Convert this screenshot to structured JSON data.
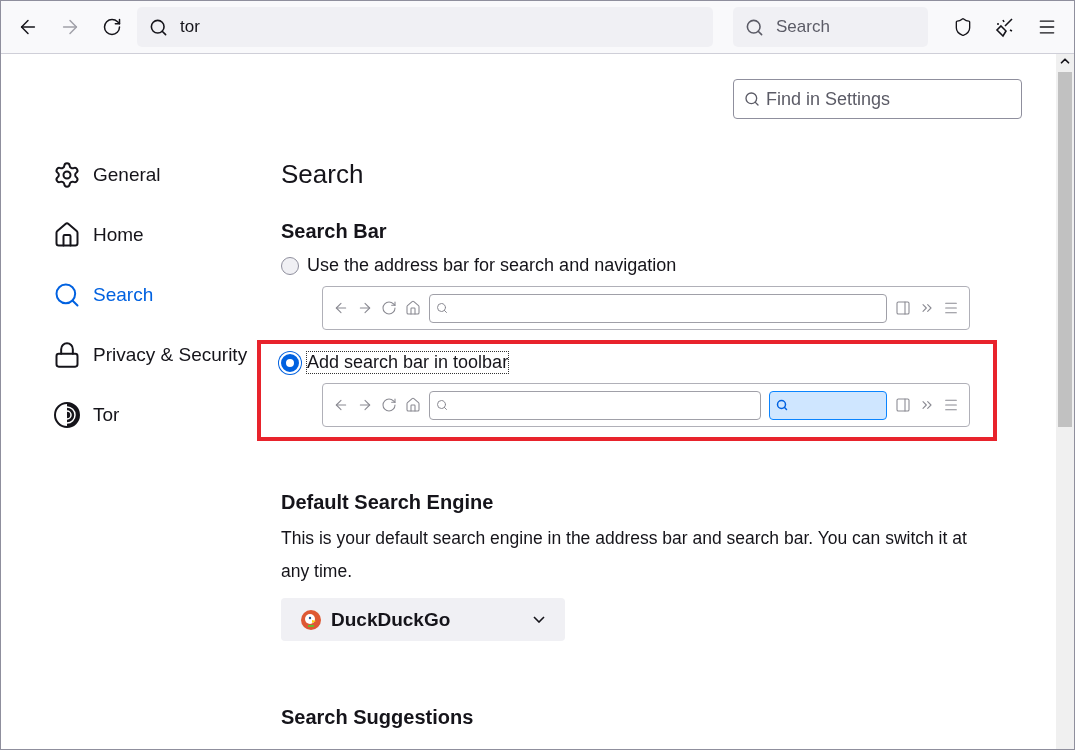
{
  "toolbar": {
    "address": "tor",
    "search_placeholder": "Search"
  },
  "find_placeholder": "Find in Settings",
  "sidebar": {
    "items": [
      {
        "label": "General",
        "selected": false
      },
      {
        "label": "Home",
        "selected": false
      },
      {
        "label": "Search",
        "selected": true
      },
      {
        "label": "Privacy & Security",
        "selected": false
      },
      {
        "label": "Tor",
        "selected": false
      }
    ]
  },
  "page_title": "Search",
  "search_bar": {
    "heading": "Search Bar",
    "options": [
      {
        "label": "Use the address bar for search and navigation",
        "selected": false,
        "highlighted": false,
        "separate_search_bar": false
      },
      {
        "label": "Add search bar in toolbar",
        "selected": true,
        "highlighted": true,
        "separate_search_bar": true
      }
    ]
  },
  "default_engine": {
    "heading": "Default Search Engine",
    "description": "This is your default search engine in the address bar and search bar. You can switch it at any time.",
    "engine": "DuckDuckGo"
  },
  "suggestions": {
    "heading": "Search Suggestions"
  }
}
